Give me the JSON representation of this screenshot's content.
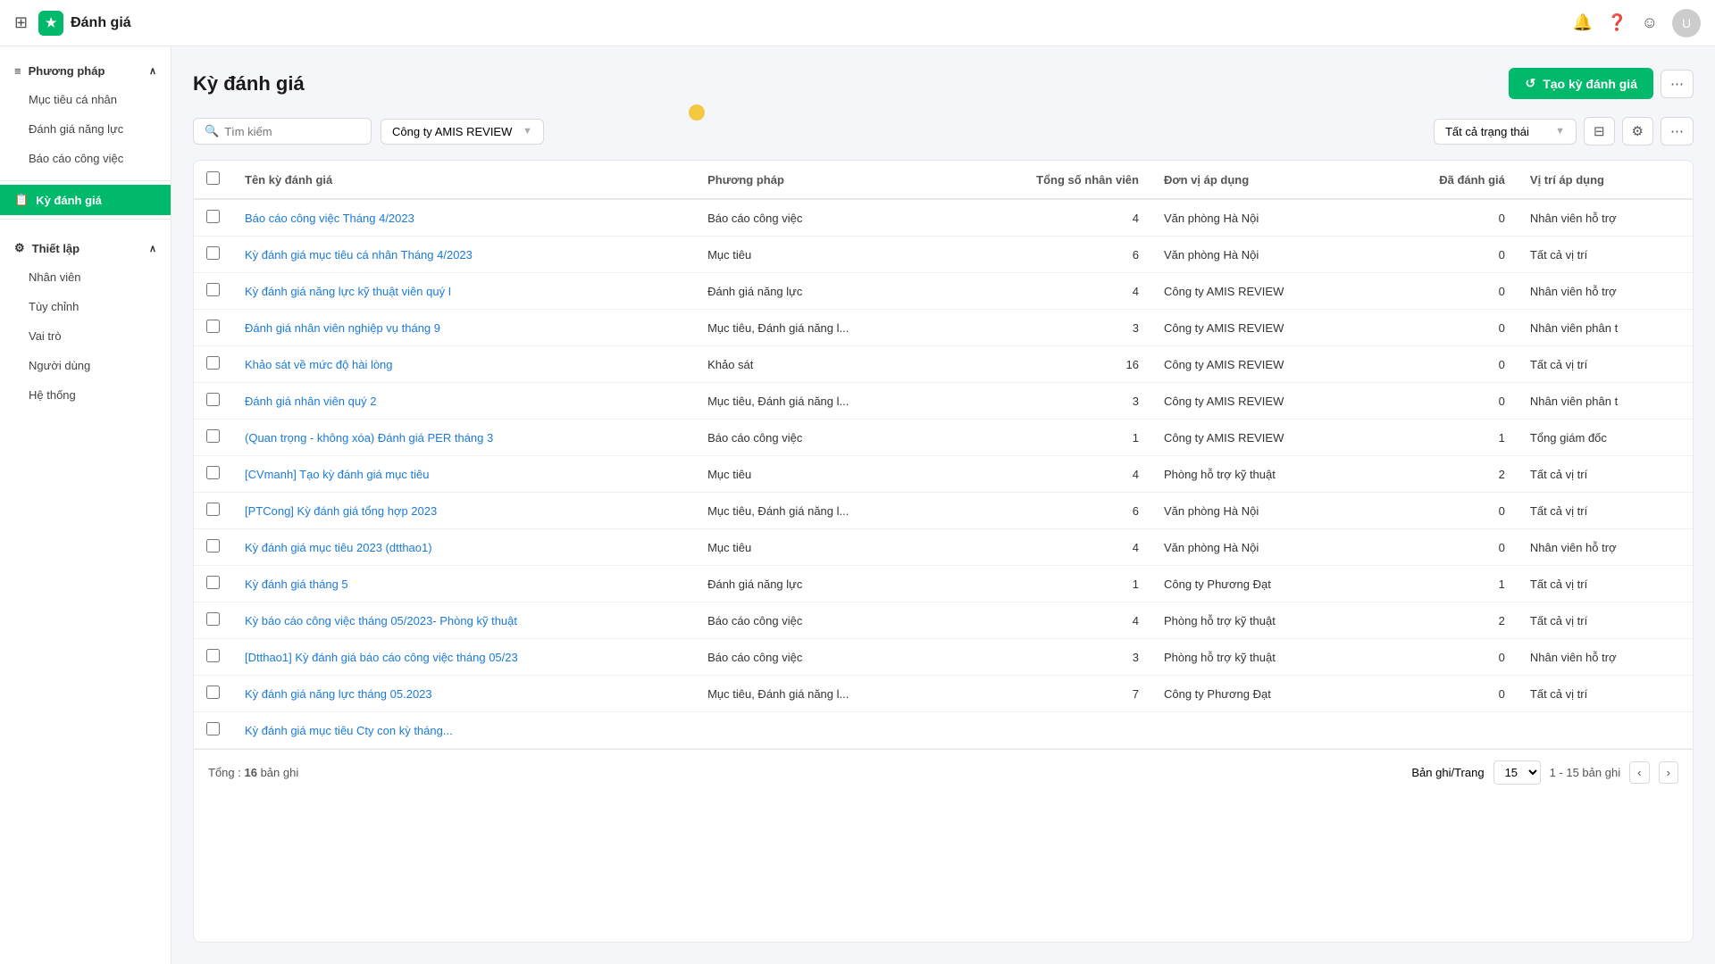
{
  "topbar": {
    "grid_icon": "⊞",
    "app_name": "Đánh giá",
    "logo_icon": "★",
    "bell_icon": "🔔",
    "help_icon": "?",
    "face_icon": "☺",
    "avatar_label": "U"
  },
  "sidebar": {
    "collapse_icon": "‹",
    "sections": [
      {
        "label": "Phương pháp",
        "icon": "≡",
        "items": [
          {
            "label": "Mục tiêu cá nhân",
            "active": false
          },
          {
            "label": "Đánh giá năng lực",
            "active": false
          },
          {
            "label": "Báo cáo công việc",
            "active": false
          }
        ]
      },
      {
        "label": "Kỳ đánh giá",
        "icon": "📋",
        "items": [],
        "active": true
      },
      {
        "label": "Thiết lập",
        "icon": "⚙",
        "items": [
          {
            "label": "Nhân viên",
            "active": false
          },
          {
            "label": "Tùy chỉnh",
            "active": false
          },
          {
            "label": "Vai trò",
            "active": false
          },
          {
            "label": "Người dùng",
            "active": false
          },
          {
            "label": "Hệ thống",
            "active": false
          }
        ]
      }
    ]
  },
  "page": {
    "title": "Kỳ đánh giá",
    "create_button": "Tạo kỳ đánh giá",
    "create_icon": "↺"
  },
  "toolbar": {
    "search_placeholder": "Tìm kiếm",
    "company_filter": "Công ty AMIS REVIEW",
    "status_filter": "Tất cả trạng thái",
    "filter_icon": "⊟",
    "settings_icon": "⚙",
    "more_icon": "⋯"
  },
  "table": {
    "columns": [
      {
        "key": "name",
        "label": "Tên kỳ đánh giá"
      },
      {
        "key": "method",
        "label": "Phương pháp"
      },
      {
        "key": "total",
        "label": "Tổng số nhân viên",
        "align": "right"
      },
      {
        "key": "unit",
        "label": "Đơn vị áp dụng"
      },
      {
        "key": "reviewed",
        "label": "Đã đánh giá",
        "align": "right"
      },
      {
        "key": "position",
        "label": "Vị trí áp dụng"
      }
    ],
    "rows": [
      {
        "name": "Báo cáo công việc Tháng 4/2023",
        "method": "Báo cáo công việc",
        "total": 4,
        "unit": "Văn phòng Hà Nội",
        "reviewed": 0,
        "position": "Nhân viên hỗ trợ"
      },
      {
        "name": "Kỳ đánh giá mục tiêu cá nhân Tháng 4/2023",
        "method": "Mục tiêu",
        "total": 6,
        "unit": "Văn phòng Hà Nội",
        "reviewed": 0,
        "position": "Tất cả vị trí"
      },
      {
        "name": "Kỳ đánh giá năng lực kỹ thuật viên quý I",
        "method": "Đánh giá năng lực",
        "total": 4,
        "unit": "Công ty AMIS REVIEW",
        "reviewed": 0,
        "position": "Nhân viên hỗ trợ"
      },
      {
        "name": "Đánh giá nhân viên nghiệp vụ tháng 9",
        "method": "Mục tiêu, Đánh giá năng l...",
        "total": 3,
        "unit": "Công ty AMIS REVIEW",
        "reviewed": 0,
        "position": "Nhân viên phân t"
      },
      {
        "name": "Khảo sát về mức độ hài lòng",
        "method": "Khảo sát",
        "total": 16,
        "unit": "Công ty AMIS REVIEW",
        "reviewed": 0,
        "position": "Tất cả vị trí"
      },
      {
        "name": "Đánh giá nhân viên quý 2",
        "method": "Mục tiêu, Đánh giá năng l...",
        "total": 3,
        "unit": "Công ty AMIS REVIEW",
        "reviewed": 0,
        "position": "Nhân viên phân t"
      },
      {
        "name": "(Quan trọng - không xóa) Đánh giá PER tháng 3",
        "method": "Báo cáo công việc",
        "total": 1,
        "unit": "Công ty AMIS REVIEW",
        "reviewed": 1,
        "position": "Tổng giám đốc"
      },
      {
        "name": "[CVmanh] Tạo kỳ đánh giá mục tiêu",
        "method": "Mục tiêu",
        "total": 4,
        "unit": "Phòng hỗ trợ kỹ thuật",
        "reviewed": 2,
        "position": "Tất cả vị trí"
      },
      {
        "name": "[PTCong] Kỳ đánh giá tổng hợp 2023",
        "method": "Mục tiêu, Đánh giá năng l...",
        "total": 6,
        "unit": "Văn phòng Hà Nội",
        "reviewed": 0,
        "position": "Tất cả vị trí"
      },
      {
        "name": "Kỳ đánh giá mục tiêu 2023 (dtthao1)",
        "method": "Mục tiêu",
        "total": 4,
        "unit": "Văn phòng Hà Nội",
        "reviewed": 0,
        "position": "Nhân viên hỗ trợ"
      },
      {
        "name": "Kỳ đánh giá tháng 5",
        "method": "Đánh giá năng lực",
        "total": 1,
        "unit": "Công ty Phương Đạt",
        "reviewed": 1,
        "position": "Tất cả vị trí"
      },
      {
        "name": "Kỳ báo cáo công việc tháng 05/2023- Phòng kỹ thuật",
        "method": "Báo cáo công việc",
        "total": 4,
        "unit": "Phòng hỗ trợ kỹ thuật",
        "reviewed": 2,
        "position": "Tất cả vị trí"
      },
      {
        "name": "[Dtthao1] Kỳ đánh giá báo cáo công việc tháng 05/23",
        "method": "Báo cáo công việc",
        "total": 3,
        "unit": "Phòng hỗ trợ kỹ thuật",
        "reviewed": 0,
        "position": "Nhân viên hỗ trợ"
      },
      {
        "name": "Kỳ đánh giá năng lực tháng 05.2023",
        "method": "Mục tiêu, Đánh giá năng l...",
        "total": 7,
        "unit": "Công ty Phương Đạt",
        "reviewed": 0,
        "position": "Tất cả vị trí"
      },
      {
        "name": "Kỳ đánh giá mục tiêu Cty con kỳ tháng...",
        "method": "",
        "total": null,
        "unit": "",
        "reviewed": null,
        "position": ""
      }
    ]
  },
  "pagination": {
    "total_label": "Tổng :",
    "total_count": 16,
    "total_suffix": "bản ghi",
    "per_page_label": "Bản ghi/Trang",
    "per_page_value": 15,
    "page_range": "1 - 15 bản ghi",
    "prev_icon": "‹",
    "next_icon": "›"
  }
}
